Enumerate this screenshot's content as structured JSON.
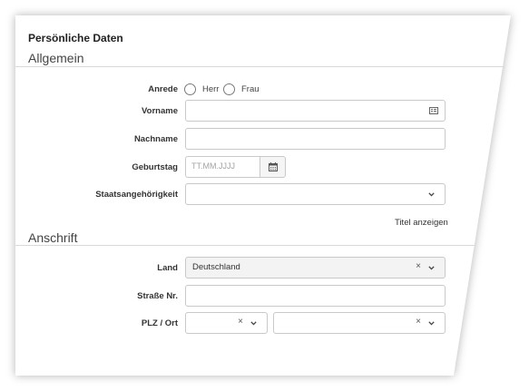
{
  "form": {
    "title": "Persönliche Daten",
    "sections": {
      "general": "Allgemein",
      "address": "Anschrift"
    },
    "fields": {
      "salutation": {
        "label": "Anrede",
        "options": [
          "Herr",
          "Frau"
        ]
      },
      "first_name": {
        "label": "Vorname",
        "value": ""
      },
      "last_name": {
        "label": "Nachname",
        "value": ""
      },
      "birthday": {
        "label": "Geburtstag",
        "placeholder": "TT.MM.JJJJ"
      },
      "nationality": {
        "label": "Staatsangehörigkeit",
        "value": ""
      },
      "show_title": "Titel anzeigen",
      "country": {
        "label": "Land",
        "value": "Deutschland"
      },
      "street": {
        "label": "Straße Nr.",
        "value": ""
      },
      "zip_city": {
        "label": "PLZ / Ort",
        "zip_value": "",
        "city_value": ""
      }
    },
    "icons": {
      "clear": "×",
      "chevron": "⌄"
    }
  }
}
